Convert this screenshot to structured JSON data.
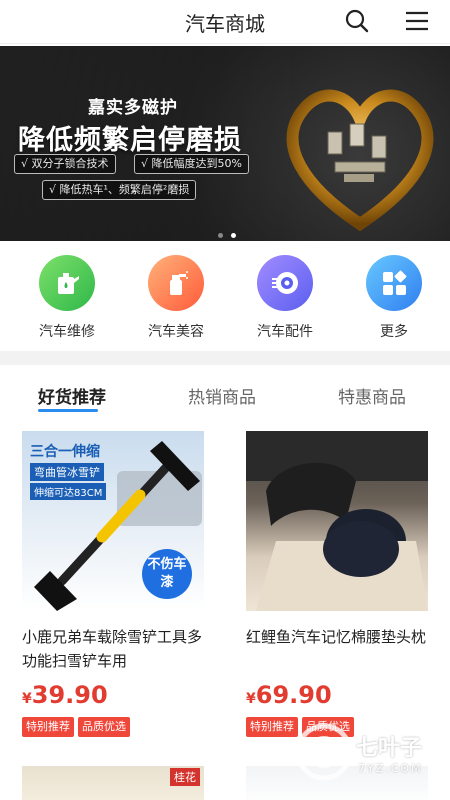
{
  "header": {
    "title": "汽车商城",
    "search_icon": "search-icon",
    "menu_icon": "menu-icon"
  },
  "banner": {
    "subtitle": "嘉实多磁护",
    "headline": "降低频繁启停磨损",
    "features": [
      "√ 双分子锁合技术",
      "√ 降低幅度达到50%",
      "√ 降低热车¹、频繁启停²磨损"
    ],
    "slides_total": 2,
    "slide_active": 2
  },
  "categories": [
    {
      "label": "汽车维修",
      "icon": "oil-can-icon",
      "color": "#2fb84a"
    },
    {
      "label": "汽车美容",
      "icon": "spray-bottle-icon",
      "color": "#ff5b3a"
    },
    {
      "label": "汽车配件",
      "icon": "tire-icon",
      "color": "#5b5ff0"
    },
    {
      "label": "更多",
      "icon": "grid-more-icon",
      "color": "#2f7ff0"
    }
  ],
  "tabs": [
    {
      "label": "好货推荐",
      "active": true
    },
    {
      "label": "热销商品",
      "active": false
    },
    {
      "label": "特惠商品",
      "active": false
    }
  ],
  "accent": "#2b8cf0",
  "price_color": "#e23b2f",
  "products": [
    {
      "name": "小鹿兄弟车载除雪铲工具多功能扫雪铲车用",
      "currency": "¥",
      "price": "39.90",
      "tags": [
        "特别推荐",
        "品质优选"
      ],
      "image_text": {
        "line1": "三合一伸缩",
        "line2": "弯曲管冰雪铲",
        "line3": "伸缩可达83CM",
        "badge": "不伤车漆"
      }
    },
    {
      "name": "红鲤鱼汽车记忆棉腰垫头枕",
      "currency": "¥",
      "price": "69.90",
      "tags": [
        "特别推荐",
        "品质优选"
      ]
    }
  ],
  "next_row": {
    "tag": "桂花"
  },
  "watermark": {
    "text": "七叶子",
    "sub": "7YZ.COM"
  }
}
